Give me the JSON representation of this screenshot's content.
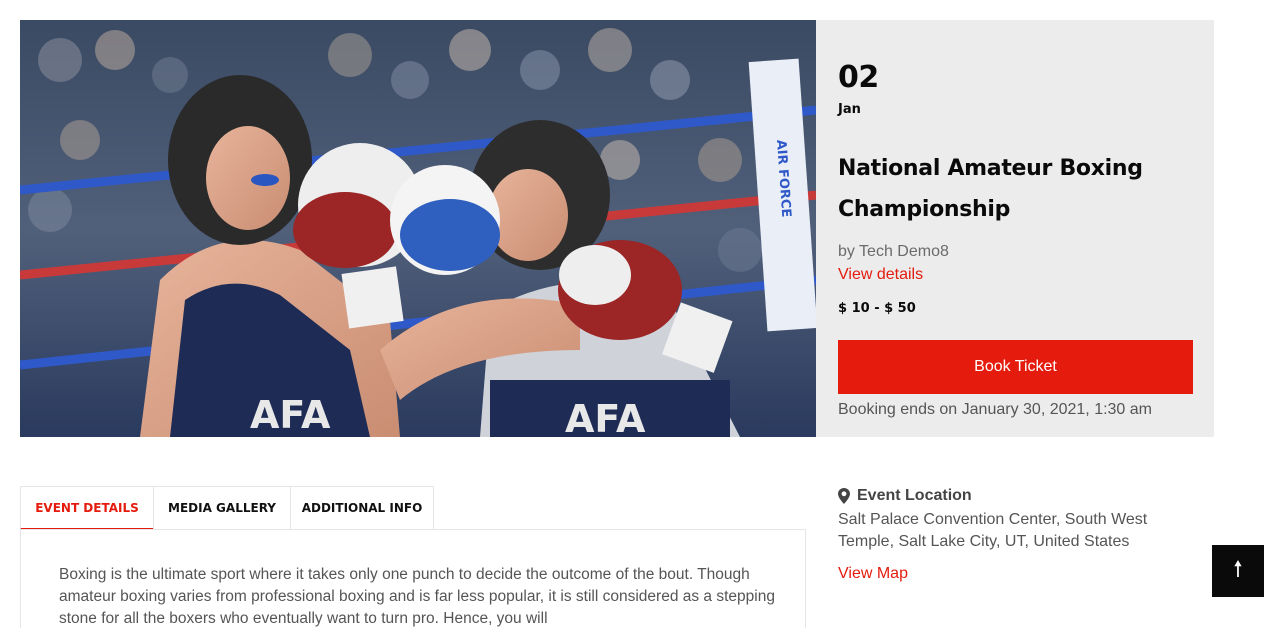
{
  "hero": {
    "image_name": "boxing-match-photo",
    "shorts_text_left": "AFA",
    "shorts_text_right": "AFA",
    "banner_text": "AIR FORCE"
  },
  "event": {
    "day": "02",
    "month": "Jan",
    "title": "National Amateur Boxing Championship",
    "organizer": "by Tech Demo8",
    "details_link": "View details",
    "price": "$ 10 - $ 50",
    "book_button": "Book Ticket",
    "booking_ends": "Booking ends on January 30, 2021, 1:30 am"
  },
  "tabs": [
    {
      "label": "EVENT DETAILS",
      "active": true
    },
    {
      "label": "MEDIA GALLERY",
      "active": false
    },
    {
      "label": "ADDITIONAL INFO",
      "active": false
    }
  ],
  "description": "Boxing is the ultimate sport where it takes only one punch to decide the outcome of the bout. Though amateur boxing varies from professional boxing and is far less popular, it is still considered as a stepping stone for all the boxers who eventually want to turn pro. Hence, you will",
  "location": {
    "heading": "Event Location",
    "address": "Salt Palace Convention Center, South West Temple, Salt Lake City, UT, United States",
    "map_link": "View Map",
    "icon": "map-pin-icon"
  },
  "back_to_top": {
    "glyph": "🠕",
    "icon": "arrow-up-icon"
  },
  "colors": {
    "accent": "#e41b0d",
    "panel_bg": "#ececec",
    "heading": "#0a0a0a"
  }
}
